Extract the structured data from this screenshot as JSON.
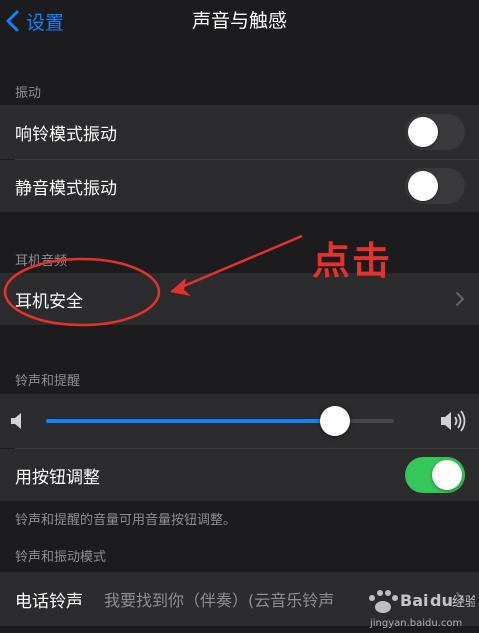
{
  "nav": {
    "back_label": "设置",
    "title": "声音与触感"
  },
  "vibration": {
    "header": "振动",
    "ring_vibrate": {
      "label": "响铃模式振动",
      "on": false
    },
    "silent_vibrate": {
      "label": "静音模式振动",
      "on": false
    }
  },
  "headphone_audio": {
    "header": "耳机音频",
    "headphone_safety_label": "耳机安全"
  },
  "ringer_alerts": {
    "header": "铃声和提醒",
    "volume_level": 0.83,
    "change_with_buttons": {
      "label": "用按钮调整",
      "on": true
    },
    "footer": "铃声和提醒的音量可用音量按钮调整。"
  },
  "sounds_patterns": {
    "header": "铃声和振动模式",
    "ringtone_label": "电话铃声",
    "ringtone_value": "我要找到你（伴奏）(云音乐铃声"
  },
  "annotation": {
    "text": "点击",
    "color": "#e5322d"
  },
  "watermark": {
    "brand": "Baidu经验",
    "site": "jingyan.baidu.com"
  },
  "colors": {
    "accent": "#0a84ff",
    "toggle_on": "#34c759",
    "background": "#1c1c1e",
    "cell": "#2c2c2e"
  }
}
